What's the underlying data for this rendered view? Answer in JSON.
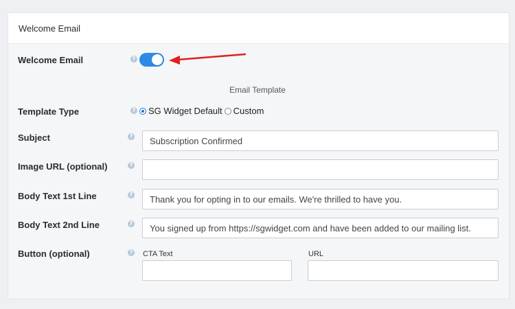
{
  "header": {
    "title": "Welcome Email"
  },
  "welcome_email": {
    "label": "Welcome Email",
    "enabled": true
  },
  "section_title": "Email Template",
  "template_type": {
    "label": "Template Type",
    "options": [
      "SG Widget Default",
      "Custom"
    ],
    "selected": "SG Widget Default"
  },
  "subject": {
    "label": "Subject",
    "value": "Subscription Confirmed"
  },
  "image_url": {
    "label": "Image URL (optional)",
    "value": ""
  },
  "body_line1": {
    "label": "Body Text 1st Line",
    "value": "Thank you for opting in to our emails. We're thrilled to have you."
  },
  "body_line2": {
    "label": "Body Text 2nd Line",
    "value": "You signed up from https://sgwidget.com and have been added to our mailing list."
  },
  "button": {
    "label": "Button (optional)",
    "cta_label": "CTA Text",
    "cta_value": "",
    "url_label": "URL",
    "url_value": ""
  },
  "help_glyph": "?",
  "colors": {
    "toggle_on": "#2b8be6",
    "arrow": "#e0201b",
    "help_icon": "#b7c9d8"
  }
}
